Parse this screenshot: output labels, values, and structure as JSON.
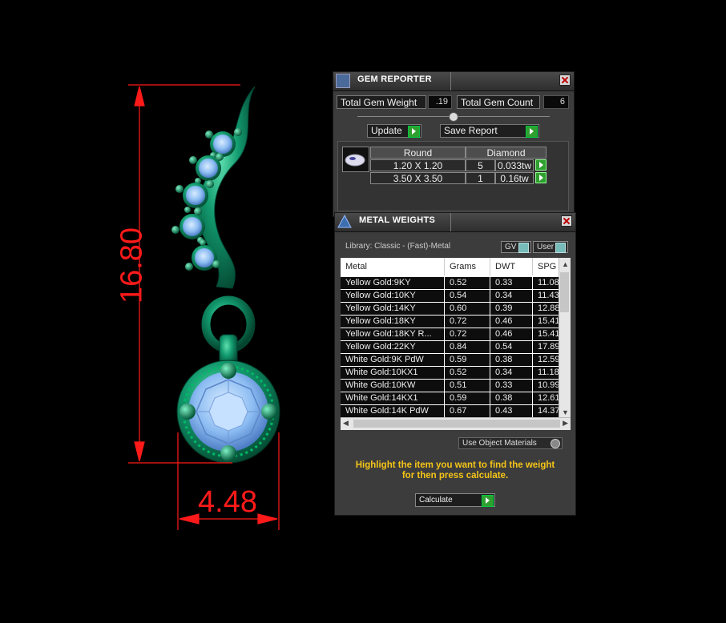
{
  "dimensions": {
    "height_label": "16.80",
    "width_label": "4.48",
    "color": "#ff1a1a"
  },
  "gem_reporter": {
    "title": "GEM REPORTER",
    "total_weight_label": "Total Gem Weight",
    "total_weight_value": ".19",
    "total_count_label": "Total Gem Count",
    "total_count_value": "6",
    "update_label": "Update",
    "save_report_label": "Save Report",
    "table": {
      "shape": "Round",
      "stone": "Diamond",
      "rows": [
        {
          "size": "1.20 X 1.20",
          "count": "5",
          "weight": "0.033tw"
        },
        {
          "size": "3.50 X 3.50",
          "count": "1",
          "weight": "0.16tw"
        }
      ]
    }
  },
  "metal_weights": {
    "title": "METAL WEIGHTS",
    "library": "Library: Classic - (Fast)-Metal",
    "gv_label": "GV",
    "user_label": "User",
    "columns": [
      "Metal",
      "Grams",
      "DWT",
      "SPG"
    ],
    "rows": [
      [
        "Yellow Gold:9KY",
        "0.52",
        "0.33",
        "11.08"
      ],
      [
        "Yellow Gold:10KY",
        "0.54",
        "0.34",
        "11.43"
      ],
      [
        "Yellow Gold:14KY",
        "0.60",
        "0.39",
        "12.88"
      ],
      [
        "Yellow Gold:18KY",
        "0.72",
        "0.46",
        "15.41"
      ],
      [
        "Yellow Gold:18KY R...",
        "0.72",
        "0.46",
        "15.41"
      ],
      [
        "Yellow Gold:22KY",
        "0.84",
        "0.54",
        "17.89"
      ],
      [
        "White Gold:9K PdW",
        "0.59",
        "0.38",
        "12.59"
      ],
      [
        "White Gold:10KX1",
        "0.52",
        "0.34",
        "11.18"
      ],
      [
        "White Gold:10KW",
        "0.51",
        "0.33",
        "10.99"
      ],
      [
        "White Gold:14KX1",
        "0.59",
        "0.38",
        "12.61"
      ],
      [
        "White Gold:14K PdW",
        "0.67",
        "0.43",
        "14.37"
      ]
    ],
    "use_object_materials_label": "Use Object Materials",
    "message_line1": "Highlight the item you want to find the weight",
    "message_line2": "for then press calculate.",
    "calculate_label": "Calculate"
  }
}
